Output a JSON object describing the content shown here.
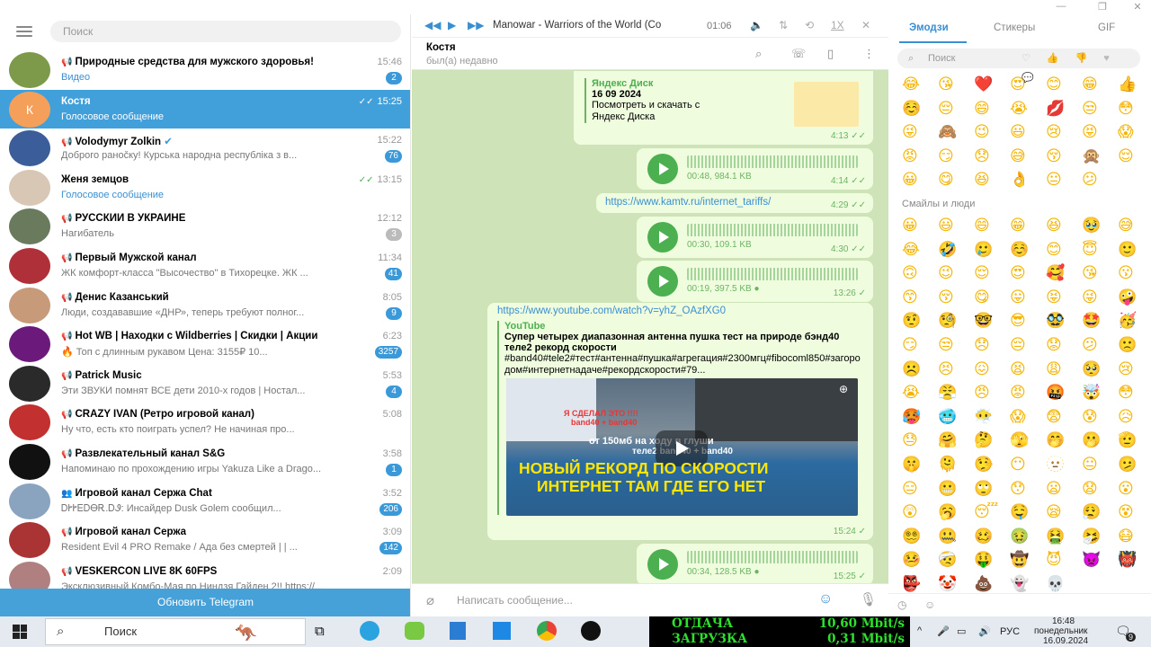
{
  "left": {
    "search_placeholder": "Поиск",
    "update_label": "Обновить Telegram",
    "chats": [
      {
        "name": "Природные средства для мужского здоровья!",
        "preview": "Видео",
        "time": "15:46",
        "badge": "2",
        "channel": true,
        "preview_blue": true
      },
      {
        "name": "Костя",
        "preview": "Голосовое сообщение",
        "time": "15:25",
        "badge": "",
        "avatar_letter": "К",
        "active": true,
        "read": true
      },
      {
        "name": "Volodymyr Zolkin",
        "preview": "Доброго ранočку! Курська народна республіка з в...",
        "time": "15:22",
        "badge": "76",
        "channel": true,
        "verified": true
      },
      {
        "name": "Женя земцов",
        "preview": "Голосовое сообщение",
        "time": "13:15",
        "badge": "",
        "preview_blue": true,
        "read": true
      },
      {
        "name": "РУССКИЙ В УКРАИНЕ",
        "preview": "Нагибатель",
        "time": "12:12",
        "badge": "3",
        "channel": true,
        "badge_grey": true
      },
      {
        "name": "Первый Мужской канал",
        "preview": "ЖК комфорт-класса \"Высочество\" в Тихорецке. ЖК ...",
        "time": "11:34",
        "badge": "41",
        "channel": true
      },
      {
        "name": "Денис Казанський",
        "preview": "Люди, создававшие «ДНР», теперь требуют полног...",
        "time": "8:05",
        "badge": "9",
        "channel": true
      },
      {
        "name": "Hot WB | Находки с Wildberries | Скидки | Акции",
        "preview": "🔥 Топ с длинным рукавом  Цена: 3155₽ 10...",
        "time": "6:23",
        "badge": "3257",
        "channel": true
      },
      {
        "name": "Patrick Music",
        "preview": "Эти ЗВУКИ помнят ВСЕ дети 2010-х годов | Ностал...",
        "time": "5:53",
        "badge": "4",
        "channel": true
      },
      {
        "name": "CRAZY IVAN (Ретро игровой канал)",
        "preview": "Ну что, есть кто поиграть успел? Не начиная про...",
        "time": "5:08",
        "badge": "",
        "channel": true
      },
      {
        "name": "Развлекательный канал S&G",
        "preview": "Напоминаю по прохождению игры Yakuza Like a Drago...",
        "time": "3:58",
        "badge": "1",
        "channel": true
      },
      {
        "name": "Игровой канал Сержа Chat",
        "preview": "ᎠᎨᎨᎬᎠᎾᎡ.ᎠᏭ:  Инсайдер Dusk Golem сообщил...",
        "time": "3:52",
        "badge": "206",
        "group": true
      },
      {
        "name": "Игровой канал Сержа",
        "preview": "Resident Evil 4 PRO Remake / Ада без смертей | | ...",
        "time": "3:09",
        "badge": "142",
        "channel": true
      },
      {
        "name": "VESKERCON LIVE 8K 60FPS",
        "preview": "Эксклюзивный Комбо-Мая по Ниндзя Гайден 2!! https://...",
        "time": "2:09",
        "badge": "",
        "channel": true
      }
    ]
  },
  "player": {
    "track": "Manowar - Warriors of the World (Co",
    "duration": "01:06",
    "speed": "1X"
  },
  "chat": {
    "name": "Костя",
    "status": "был(а) недавно",
    "composer_placeholder": "Написать сообщение...",
    "disk_preview": {
      "site": "Яндекс Диск",
      "title": "16 09 2024",
      "desc": "Посмотреть и скачать с Яндекс Диска",
      "time": "4:13"
    },
    "voice1": {
      "meta": "00:48, 984.1 KB",
      "time": "4:14"
    },
    "link1": {
      "url": "https://www.kamtv.ru/internet_tariffs/",
      "time": "4:29"
    },
    "voice2": {
      "meta": "00:30, 109.1 KB",
      "time": "4:30"
    },
    "voice3": {
      "meta": "00:19, 397.5 KB",
      "time": "13:26"
    },
    "youtube": {
      "url": "https://www.youtube.com/watch?v=yhZ_OAzfXG0",
      "site": "YouTube",
      "title": "Супер четырех диапазонная антенна пушка тест на природе бэнд40 теле2 рекорд скорости",
      "desc": "#band40#tele2#тест#антенна#пушка#агрегация#2300мгц#fibocoml850#загородом#интернетнадаче#рекордскорости#79...",
      "thumb_line1": "Я СДЕЛАЛ ЭТО !!!!",
      "thumb_line2": "band40 + band40",
      "thumb_line3": "от 150мб на ходу в глуши",
      "thumb_line4": "теле2 band40 + band40",
      "thumb_big1": "НОВЫЙ РЕКОРД ПО СКОРОСТИ",
      "thumb_big2": "ИНТЕРНЕТ ТАМ ГДЕ ЕГО НЕТ",
      "time": "15:24"
    },
    "voice4": {
      "meta": "00:34, 128.5 KB",
      "time": "15:25"
    }
  },
  "emoji_panel": {
    "tabs": [
      "Эмодзи",
      "Стикеры",
      "GIF"
    ],
    "search_placeholder": "Поиск",
    "category_label": "Смайлы и люди",
    "recent": [
      "😂",
      "😘",
      "❤️",
      "😍",
      "😊",
      "😁",
      "👍",
      "☺️",
      "😔",
      "😄",
      "😭",
      "💋",
      "😒",
      "😳",
      "😜",
      "🙈",
      "😉",
      "😃",
      "😢",
      "😝",
      "😱",
      "😡",
      "😏",
      "😞",
      "😅",
      "😚",
      "🙊",
      "😌",
      "😀",
      "😋",
      "😆",
      "👌",
      "😐",
      "😕"
    ],
    "smileys": [
      "😀",
      "😃",
      "😄",
      "😁",
      "😆",
      "🥹",
      "😅",
      "😂",
      "🤣",
      "🥲",
      "☺️",
      "😊",
      "😇",
      "🙂",
      "🙃",
      "😉",
      "😌",
      "😍",
      "🥰",
      "😘",
      "😗",
      "😙",
      "😚",
      "😋",
      "😛",
      "😝",
      "😜",
      "🤪",
      "🤨",
      "🧐",
      "🤓",
      "😎",
      "🥸",
      "🤩",
      "🥳",
      "😏",
      "😒",
      "😞",
      "😔",
      "😟",
      "😕",
      "🙁",
      "☹️",
      "😣",
      "😖",
      "😫",
      "😩",
      "🥺",
      "😢",
      "😭",
      "😤",
      "😠",
      "😡",
      "🤬",
      "🤯",
      "😳",
      "🥵",
      "🥶",
      "😶‍🌫️",
      "😱",
      "😨",
      "😰",
      "😥",
      "😓",
      "🤗",
      "🤔",
      "🫣",
      "🤭",
      "🫢",
      "🫡",
      "🤫",
      "🫠",
      "🤥",
      "😶",
      "🫥",
      "😐",
      "🫤",
      "😑",
      "😬",
      "🙄",
      "😯",
      "😦",
      "😧",
      "😮",
      "😲",
      "🥱",
      "😴",
      "🤤",
      "😪",
      "😮‍💨",
      "😵",
      "😵‍💫",
      "🤐",
      "🥴",
      "🤢",
      "🤮",
      "🤧",
      "😷",
      "🤒",
      "🤕",
      "🤑",
      "🤠",
      "😈",
      "👿",
      "👹",
      "👺",
      "🤡",
      "💩",
      "👻",
      "💀"
    ]
  },
  "taskbar": {
    "search_label": "Поиск",
    "net_up_label": "ОТДАЧА",
    "net_down_label": "ЗАГРУЗКА",
    "net_up_value": "10,60 Mbit/s",
    "net_down_value": "0,31 Mbit/s",
    "lang": "РУС",
    "time": "16:48",
    "day": "понедельник",
    "date": "16.09.2024",
    "notif_count": "9"
  }
}
